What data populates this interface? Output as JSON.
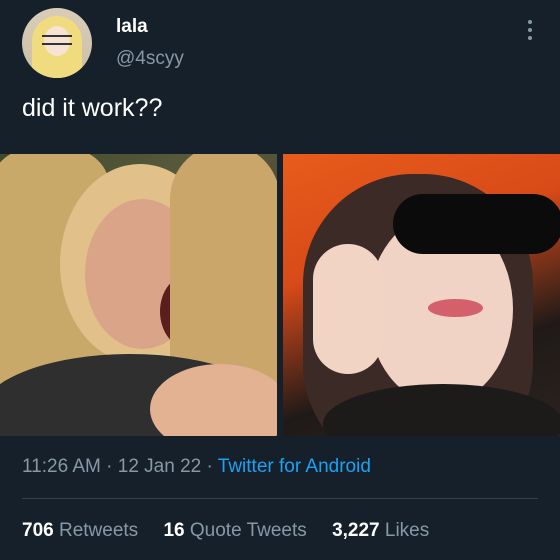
{
  "tweet": {
    "author_name": "lala",
    "author_handle": "@4scyy",
    "text": "did it work??"
  },
  "meta": {
    "time": "11:26 AM",
    "date": "12 Jan 22",
    "separator": "·",
    "source": "Twitter for Android"
  },
  "stats": {
    "retweets_count": "706",
    "retweets_label": "Retweets",
    "quotes_count": "16",
    "quotes_label": "Quote Tweets",
    "likes_count": "3,227",
    "likes_label": "Likes"
  },
  "icons": {
    "more": "more-vertical-icon"
  },
  "colors": {
    "background": "#15202b",
    "secondary_text": "#8899a6",
    "link": "#1da1f2",
    "divider": "#38444d"
  }
}
